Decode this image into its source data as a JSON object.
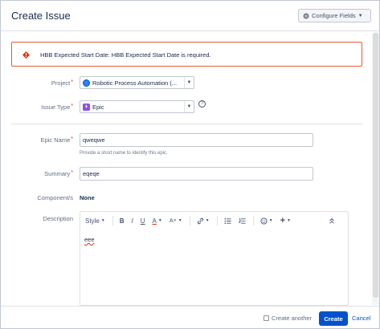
{
  "dialog": {
    "title": "Create Issue"
  },
  "header": {
    "configure_fields": "Configure Fields"
  },
  "error": {
    "message": "HBB Expected Start Date: HBB Expected Start Date is required."
  },
  "fields": {
    "project": {
      "label": "Project",
      "value": "Robotic Process Automation (..."
    },
    "issue_type": {
      "label": "Issue Type",
      "value": "Epic"
    },
    "epic_name": {
      "label": "Epic Name",
      "value": "qweqwe",
      "hint": "Provide a short name to identify this epic."
    },
    "summary": {
      "label": "Summary",
      "value": "eqeqe"
    },
    "components": {
      "label": "Component/s",
      "value": "None"
    },
    "description": {
      "label": "Description",
      "value": "eee"
    }
  },
  "editor_toolbar": {
    "style": "Style",
    "bold": "B",
    "italic": "I",
    "underline": "U",
    "text_color": "A",
    "more_format": "A",
    "plus": "+"
  },
  "footer": {
    "create_another": "Create another",
    "create": "Create",
    "cancel": "Cancel"
  },
  "colors": {
    "primary": "#0052cc",
    "error_border": "#de5f3b",
    "required": "#de350b",
    "epic": "#904ee2"
  },
  "icons": [
    "gear-icon",
    "error-icon",
    "project-avatar-icon",
    "epic-icon",
    "help-icon",
    "link-icon",
    "bullet-list-icon",
    "numbered-list-icon",
    "emoji-icon",
    "collapse-icon"
  ]
}
